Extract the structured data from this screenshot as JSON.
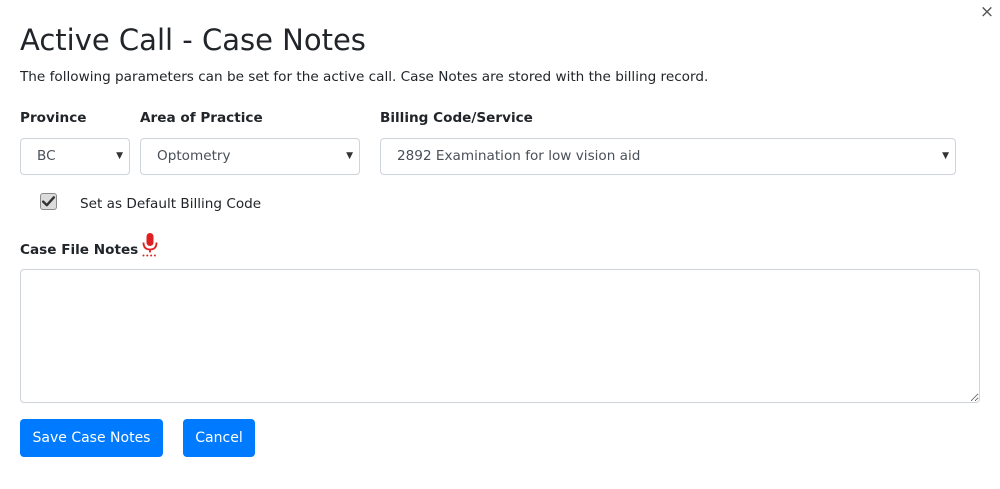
{
  "dialog": {
    "title": "Active Call - Case Notes",
    "description": "The following parameters can be set for the active call. Case Notes are stored with the billing record.",
    "close_symbol": "×"
  },
  "fields": {
    "province": {
      "label": "Province",
      "value": "BC"
    },
    "area_of_practice": {
      "label": "Area of Practice",
      "value": "Optometry"
    },
    "billing_code": {
      "label": "Billing Code/Service",
      "value": "2892 Examination for low vision aid"
    }
  },
  "default_billing": {
    "label": "Set as Default Billing Code",
    "checked": true
  },
  "notes": {
    "label": "Case File Notes",
    "value": ""
  },
  "buttons": {
    "save": "Save Case Notes",
    "cancel": "Cancel"
  },
  "icons": {
    "close": "close-icon",
    "mic": "microphone-icon",
    "check": "check-icon",
    "caret": "caret-down-icon"
  },
  "colors": {
    "primary": "#007bff",
    "mic": "#e02020",
    "text": "#212529"
  }
}
